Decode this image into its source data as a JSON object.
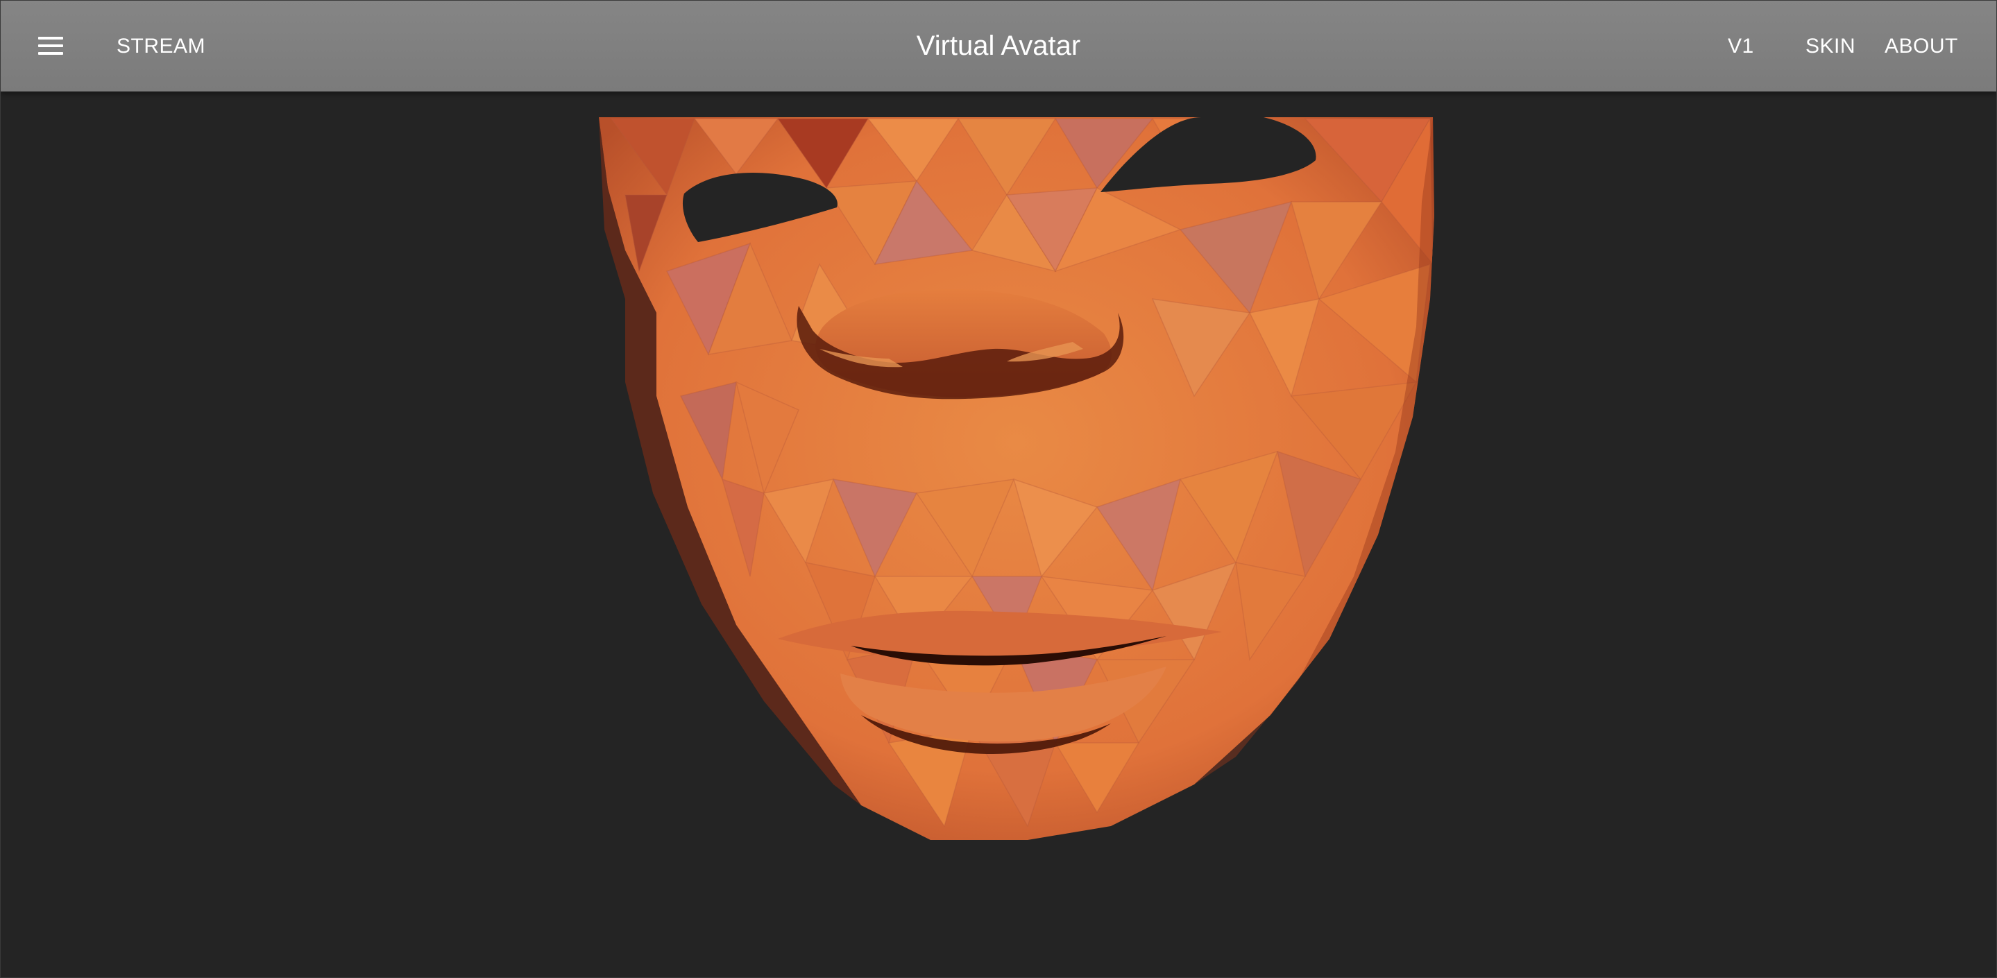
{
  "app": {
    "title": "Virtual Avatar"
  },
  "nav": {
    "left": [
      {
        "label": "STREAM"
      }
    ],
    "right": [
      {
        "label": "V1"
      },
      {
        "label": "SKIN"
      },
      {
        "label": "ABOUT"
      }
    ]
  },
  "icons": {
    "menu": "menu-icon"
  },
  "theme": {
    "toolbar": "#808080",
    "background": "#242424",
    "mesh_primary": "#e5793a",
    "mesh_secondary": "#c86a5e",
    "mesh_shadow": "#8a2d14"
  }
}
